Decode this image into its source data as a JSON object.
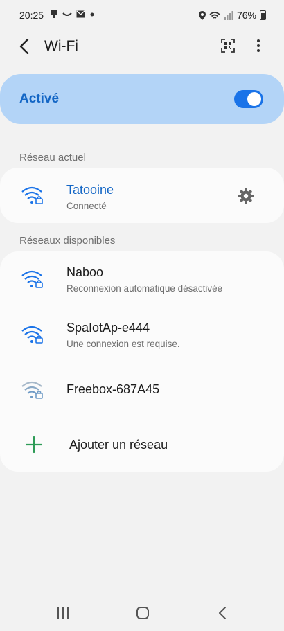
{
  "status_bar": {
    "time": "20:25",
    "battery": "76%",
    "icons": [
      "notification-icon",
      "voicemail-icon",
      "mail-icon",
      "dot-icon",
      "location-icon",
      "wifi-status-icon",
      "signal-icon",
      "battery-icon"
    ]
  },
  "header": {
    "title": "Wi-Fi",
    "icons": [
      "back-icon",
      "qr-code-icon",
      "more-options-icon"
    ]
  },
  "master_switch": {
    "label": "Activé",
    "state": "on",
    "accent_color": "#1a73e8"
  },
  "current_network": {
    "section_label": "Réseau actuel",
    "name": "Tatooine",
    "status": "Connecté"
  },
  "available_networks": {
    "section_label": "Réseaux disponibles",
    "items": [
      {
        "name": "Naboo",
        "subtitle": "Reconnexion automatique désactivée"
      },
      {
        "name": "SpaIotAp-e444",
        "subtitle": "Une connexion est requise."
      },
      {
        "name": "Freebox-687A45",
        "subtitle": ""
      }
    ],
    "add_label": "Ajouter un réseau"
  },
  "nav_bar": {
    "icons": [
      "recent-apps-icon",
      "home-icon",
      "back-nav-icon"
    ]
  }
}
